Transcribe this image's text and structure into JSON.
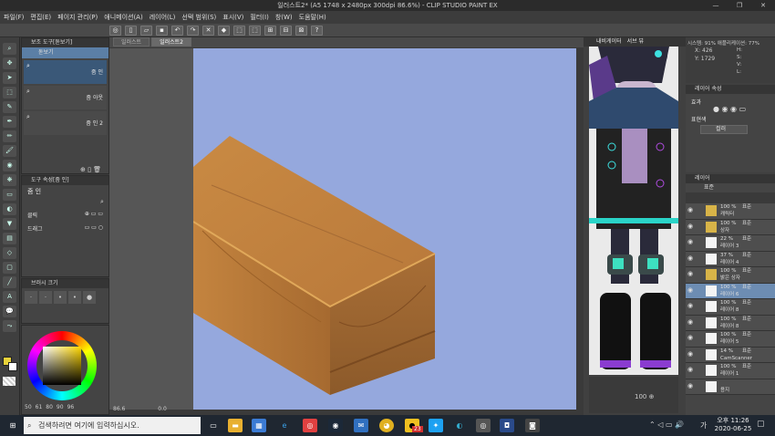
{
  "window": {
    "title": "일러스트2* (A5 1748 x 2480px 300dpi 86.6%) - CLIP STUDIO PAINT EX",
    "min": "—",
    "max": "❐",
    "close": "✕"
  },
  "menu": [
    "파일(F)",
    "편집(E)",
    "페이지 관리(P)",
    "애니메이션(A)",
    "레이어(L)",
    "선택 범위(S)",
    "표시(V)",
    "필터(I)",
    "창(W)",
    "도움말(H)"
  ],
  "tabs": [
    "일러스트",
    "일러스트2"
  ],
  "subtool_panel": {
    "title": "보조 도구[돋보기]",
    "items": [
      "돋보기",
      "줌 인",
      "줌 아웃",
      "줌 인 2"
    ]
  },
  "tool_prop": {
    "title": "도구 속성[줌 인]",
    "name": "줌 인",
    "rows": [
      "클릭",
      "드래그"
    ]
  },
  "brush_size": {
    "title": "브러시 크기",
    "values": [
      "50",
      "61",
      "80",
      "90",
      "96"
    ]
  },
  "status": {
    "zoom": "86.6",
    "coord": "0.0"
  },
  "nav": {
    "tab1": "내비게이터",
    "tab2": "서브 뷰",
    "info": "시스템: 91% 애플리케이션: 77%",
    "x": "X: 426",
    "y": "Y: 1729",
    "h": "H:",
    "s": "S:",
    "v": "V:",
    "l": "L:"
  },
  "layer_prop": {
    "title": "레이어 속성",
    "effect": "효과",
    "expression": "표현색",
    "color": "컬러"
  },
  "layers": {
    "title": "레이어",
    "blend": "표준",
    "items": [
      {
        "pct": "100 %",
        "mode": "표준",
        "name": "캐릭터",
        "folder": true
      },
      {
        "pct": "100 %",
        "mode": "표준",
        "name": "상자",
        "folder": true
      },
      {
        "pct": "22 %",
        "mode": "표준",
        "name": "레이어 3"
      },
      {
        "pct": "37 %",
        "mode": "표준",
        "name": "레이어 4"
      },
      {
        "pct": "100 %",
        "mode": "표준",
        "name": "밝은 상자",
        "folder": true
      },
      {
        "pct": "100 %",
        "mode": "표준",
        "name": "레이어 6"
      },
      {
        "pct": "100 %",
        "mode": "표준",
        "name": "레이어 8"
      },
      {
        "pct": "100 %",
        "mode": "표준",
        "name": "레이어 8"
      },
      {
        "pct": "100 %",
        "mode": "표준",
        "name": "레이어 5"
      },
      {
        "pct": "14 %",
        "mode": "표준",
        "name": "CamScanner"
      },
      {
        "pct": "100 %",
        "mode": "표준",
        "name": "레이어 1"
      },
      {
        "pct": "",
        "mode": "",
        "name": "용지"
      }
    ]
  },
  "taskbar": {
    "search": "검색하려면 여기에 입력하십시오.",
    "time": "오후 11:26",
    "date": "2020-06-25",
    "badge": "23",
    "lang": "가"
  },
  "colors": {
    "canvas": "#95a8dd",
    "accent": "#3aa0d8"
  }
}
